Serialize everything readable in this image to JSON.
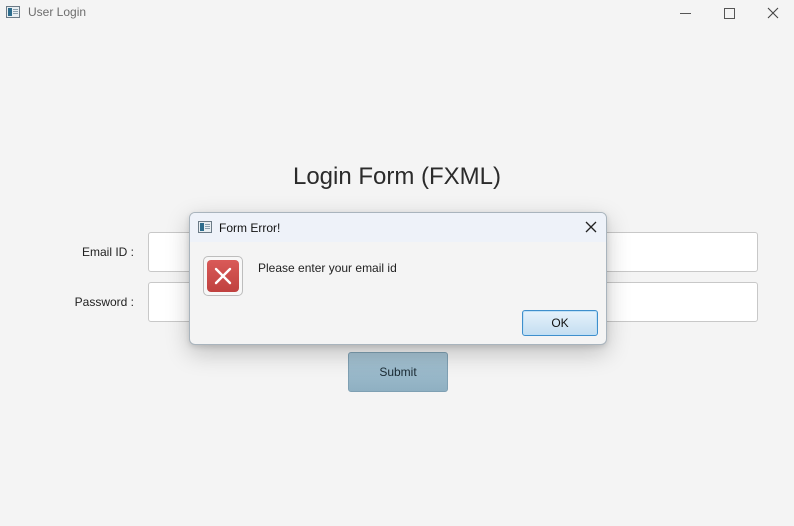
{
  "window": {
    "title": "User Login",
    "icon": "app-window-icon",
    "controls": [
      "minimize-icon",
      "maximize-icon",
      "close-icon"
    ]
  },
  "form": {
    "title": "Login Form (FXML)",
    "email_label": "Email ID :",
    "email_value": "",
    "password_label": "Password :",
    "password_value": "",
    "submit_label": "Submit",
    "submit_color": "#98b8ca"
  },
  "dialog": {
    "title": "Form Error!",
    "icon": "app-window-icon",
    "close_icon": "close-icon",
    "error_icon": "error-x-icon",
    "error_color": "#cc4b49",
    "message": "Please enter your email id",
    "ok_label": "OK",
    "ok_border_color": "#3f8fcc"
  }
}
